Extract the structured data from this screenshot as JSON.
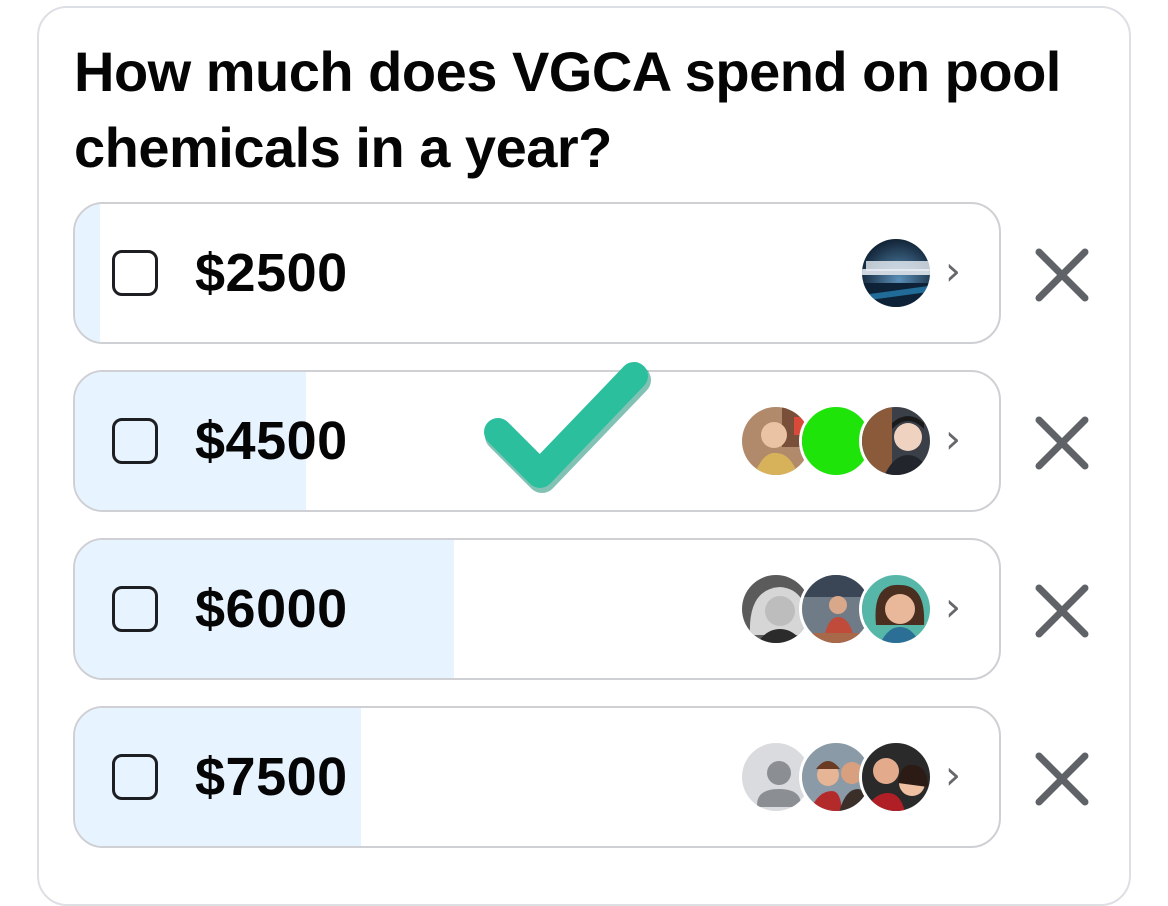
{
  "poll": {
    "question": "How much does VGCA spend on pool chemicals in a year?",
    "options": [
      {
        "label": "$2500",
        "vote_fill_pct": 3,
        "voters": [
          "avatar-starwars-troopers"
        ]
      },
      {
        "label": "$4500",
        "vote_fill_pct": 25,
        "voters": [
          "avatar-person-photo",
          "avatar-green-circle",
          "avatar-child-photo"
        ]
      },
      {
        "label": "$6000",
        "vote_fill_pct": 41,
        "voters": [
          "avatar-woman-bw",
          "avatar-event-photo",
          "avatar-woman-smiling"
        ]
      },
      {
        "label": "$7500",
        "vote_fill_pct": 31,
        "voters": [
          "avatar-default-silhouette",
          "avatar-couple-photo",
          "avatar-couple-selfie"
        ]
      }
    ]
  },
  "icons": {
    "chevron": "chevron-right-icon",
    "remove": "close-icon",
    "checkmark": "checkmark-icon",
    "checkbox": "checkbox-icon"
  },
  "colors": {
    "fill": "#e7f3ff",
    "checkmark": "#2bbf9e",
    "text": "#050505",
    "close": "#5f6368"
  }
}
